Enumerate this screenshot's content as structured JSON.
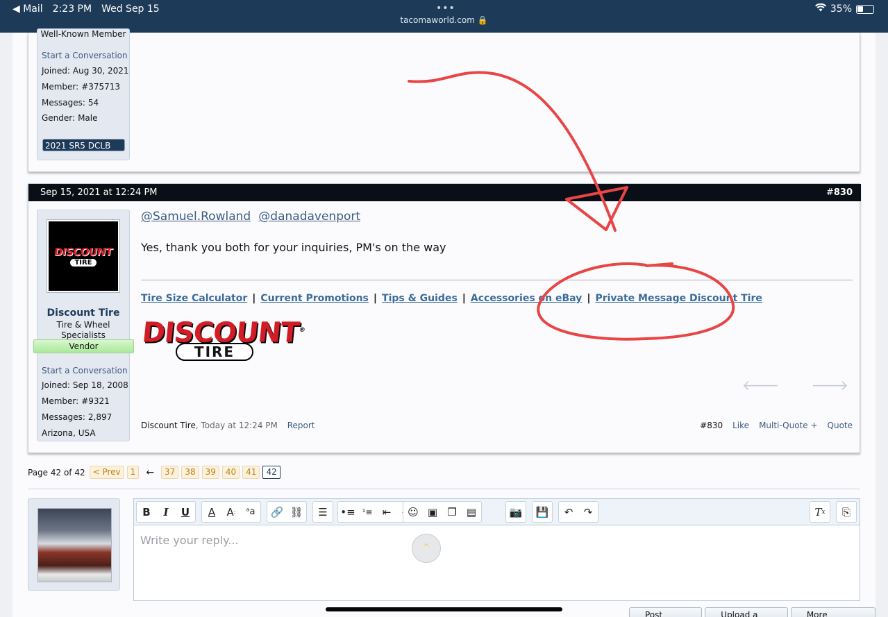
{
  "status_bar": {
    "back_app": "◀ Mail",
    "time": "2:23 PM",
    "date": "Wed Sep 15",
    "dots": "•••",
    "url": "tacomaworld.com 🔒",
    "battery": "35%"
  },
  "post1_user": {
    "title": "Well-Known Member",
    "start_conversation": "Start a Conversation",
    "joined_label": "Joined:",
    "joined": "Aug 30, 2021",
    "member_label": "Member:",
    "member": "#375713",
    "messages_label": "Messages:",
    "messages": "54",
    "gender_label": "Gender:",
    "gender": "Male",
    "vehicle": "2021 SR5 DCLB"
  },
  "post2": {
    "date": "Sep 15, 2021 at 12:24 PM",
    "number_hash": "#",
    "number": "830",
    "user": {
      "avatar_logo_top": "DISCOUNT",
      "avatar_logo_bottom": "TIRE",
      "name": "Discount Tire",
      "title_line1": "Tire & Wheel",
      "title_line2": "Specialists",
      "vendor": "Vendor",
      "start_conversation": "Start a Conversation",
      "joined_label": "Joined:",
      "joined": "Sep 18, 2008",
      "member_label": "Member:",
      "member": "#9321",
      "messages_label": "Messages:",
      "messages": "2,897",
      "location": "Arizona, USA"
    },
    "mentions": [
      "@Samuel.Rowland",
      "@danadavenport"
    ],
    "message": "Yes, thank you both for your inquiries, PM's on the way",
    "sig_links": [
      "Tire Size Calculator",
      "Current Promotions",
      "Tips & Guides",
      "Accessories on eBay",
      "Private Message Discount Tire"
    ],
    "sig_separator": "|",
    "logo_top": "DISCOUNT",
    "logo_bottom": "TIRE",
    "logo_mark": "®",
    "footer": {
      "author": "Discount Tire",
      "time": ", Today at 12:24 PM",
      "report": "Report",
      "post_num": "#830",
      "like": "Like",
      "multi_quote": "Multi-Quote +",
      "quote": "Quote"
    }
  },
  "pagination": {
    "label": "Page 42 of 42",
    "prev": "< Prev",
    "first": "1",
    "ellipsis_arrow": "←",
    "pages": [
      "37",
      "38",
      "39",
      "40",
      "41"
    ],
    "current": "42"
  },
  "editor": {
    "placeholder": "Write your reply...",
    "buttons": {
      "post_reply": "Post Reply",
      "upload_file": "Upload a File",
      "more_options": "More Options"
    }
  },
  "colors": {
    "header_bg": "#1d3a58",
    "post_header_bg": "#0a0e16",
    "link": "#3b5b80",
    "brand_red": "#d31d26",
    "annotation_red": "#e84545"
  }
}
